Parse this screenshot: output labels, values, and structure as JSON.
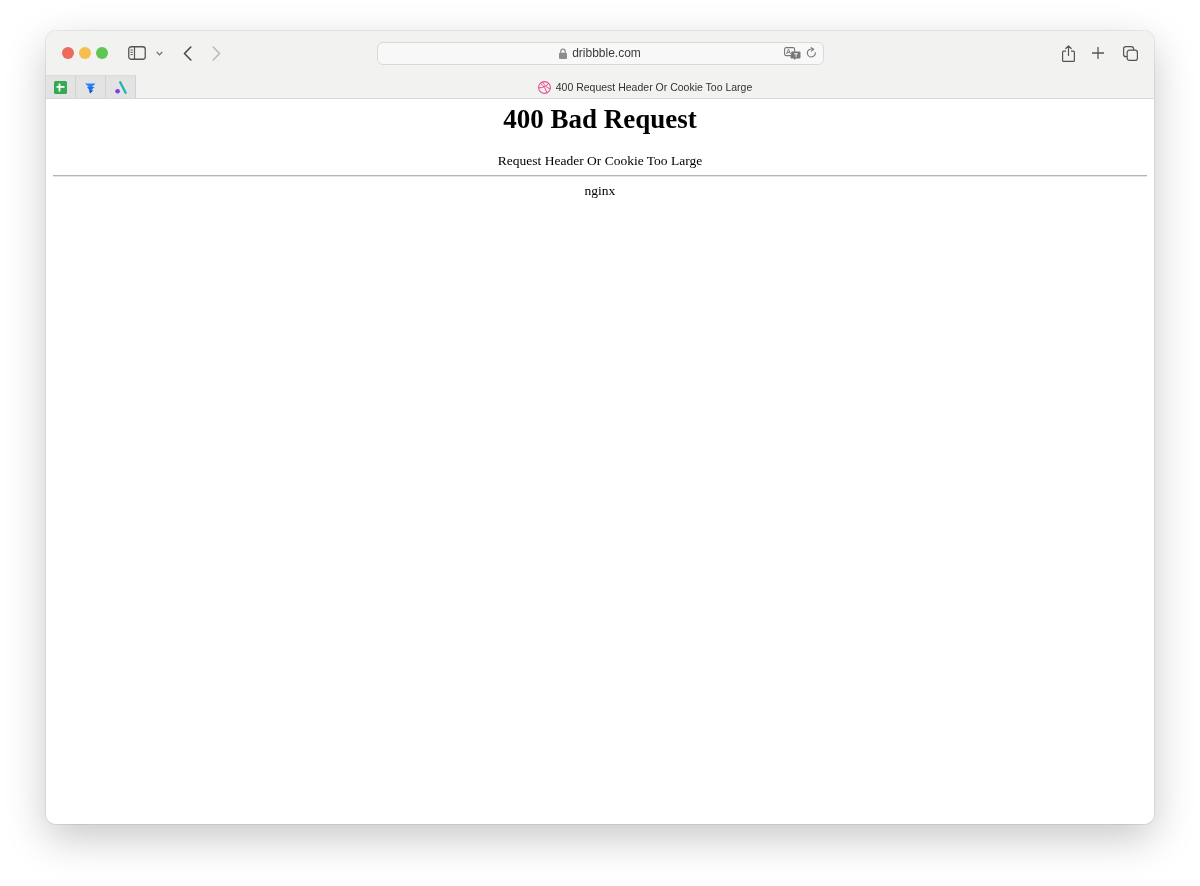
{
  "toolbar": {
    "back": {
      "disabled": false
    },
    "forward": {
      "disabled": true
    },
    "address": "dribbble.com"
  },
  "tabs": [
    {
      "kind": "pinned",
      "selected": false
    },
    {
      "kind": "pinned",
      "selected": false
    },
    {
      "kind": "pinned",
      "selected": false
    },
    {
      "kind": "page",
      "title": "400 Request Header Or Cookie Too Large",
      "selected": true
    }
  ],
  "page": {
    "heading": "400 Bad Request",
    "message": "Request Header Or Cookie Too Large",
    "server": "nginx"
  }
}
